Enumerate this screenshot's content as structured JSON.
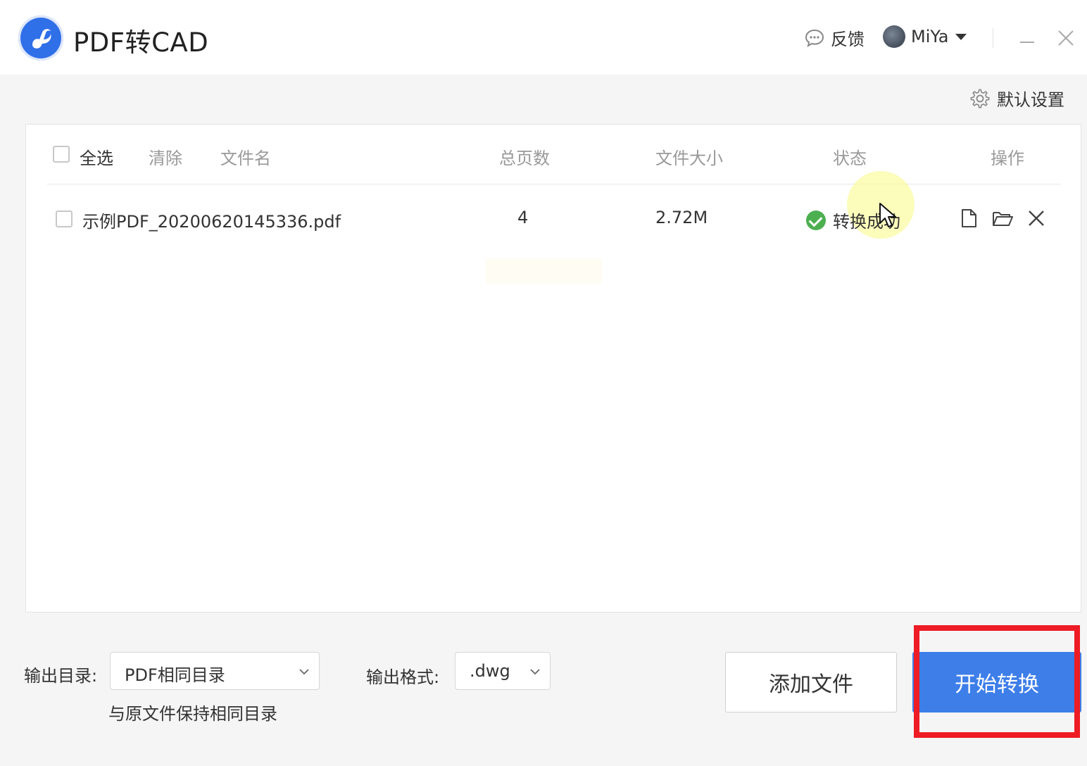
{
  "app": {
    "title": "PDF转CAD",
    "accent": "#3d7ee8"
  },
  "header": {
    "feedback": "反馈",
    "user": "MiYa"
  },
  "toolbar": {
    "settings": "默认设置"
  },
  "table": {
    "select_all": "全选",
    "clear": "清除",
    "columns": {
      "filename": "文件名",
      "pages": "总页数",
      "size": "文件大小",
      "status": "状态",
      "actions": "操作"
    },
    "rows": [
      {
        "filename": "示例PDF_20200620145336.pdf",
        "pages": "4",
        "size": "2.72M",
        "status": "转换成功"
      }
    ]
  },
  "bottom": {
    "output_dir_label": "输出目录:",
    "output_dir_value": "PDF相同目录",
    "output_dir_hint": "与原文件保持相同目录",
    "output_format_label": "输出格式:",
    "output_format_value": ".dwg",
    "add_file": "添加文件",
    "start": "开始转换"
  },
  "colors": {
    "success": "#4caf50",
    "highlight_box": "#ee1c24",
    "button_primary": "#3d7ee8"
  }
}
